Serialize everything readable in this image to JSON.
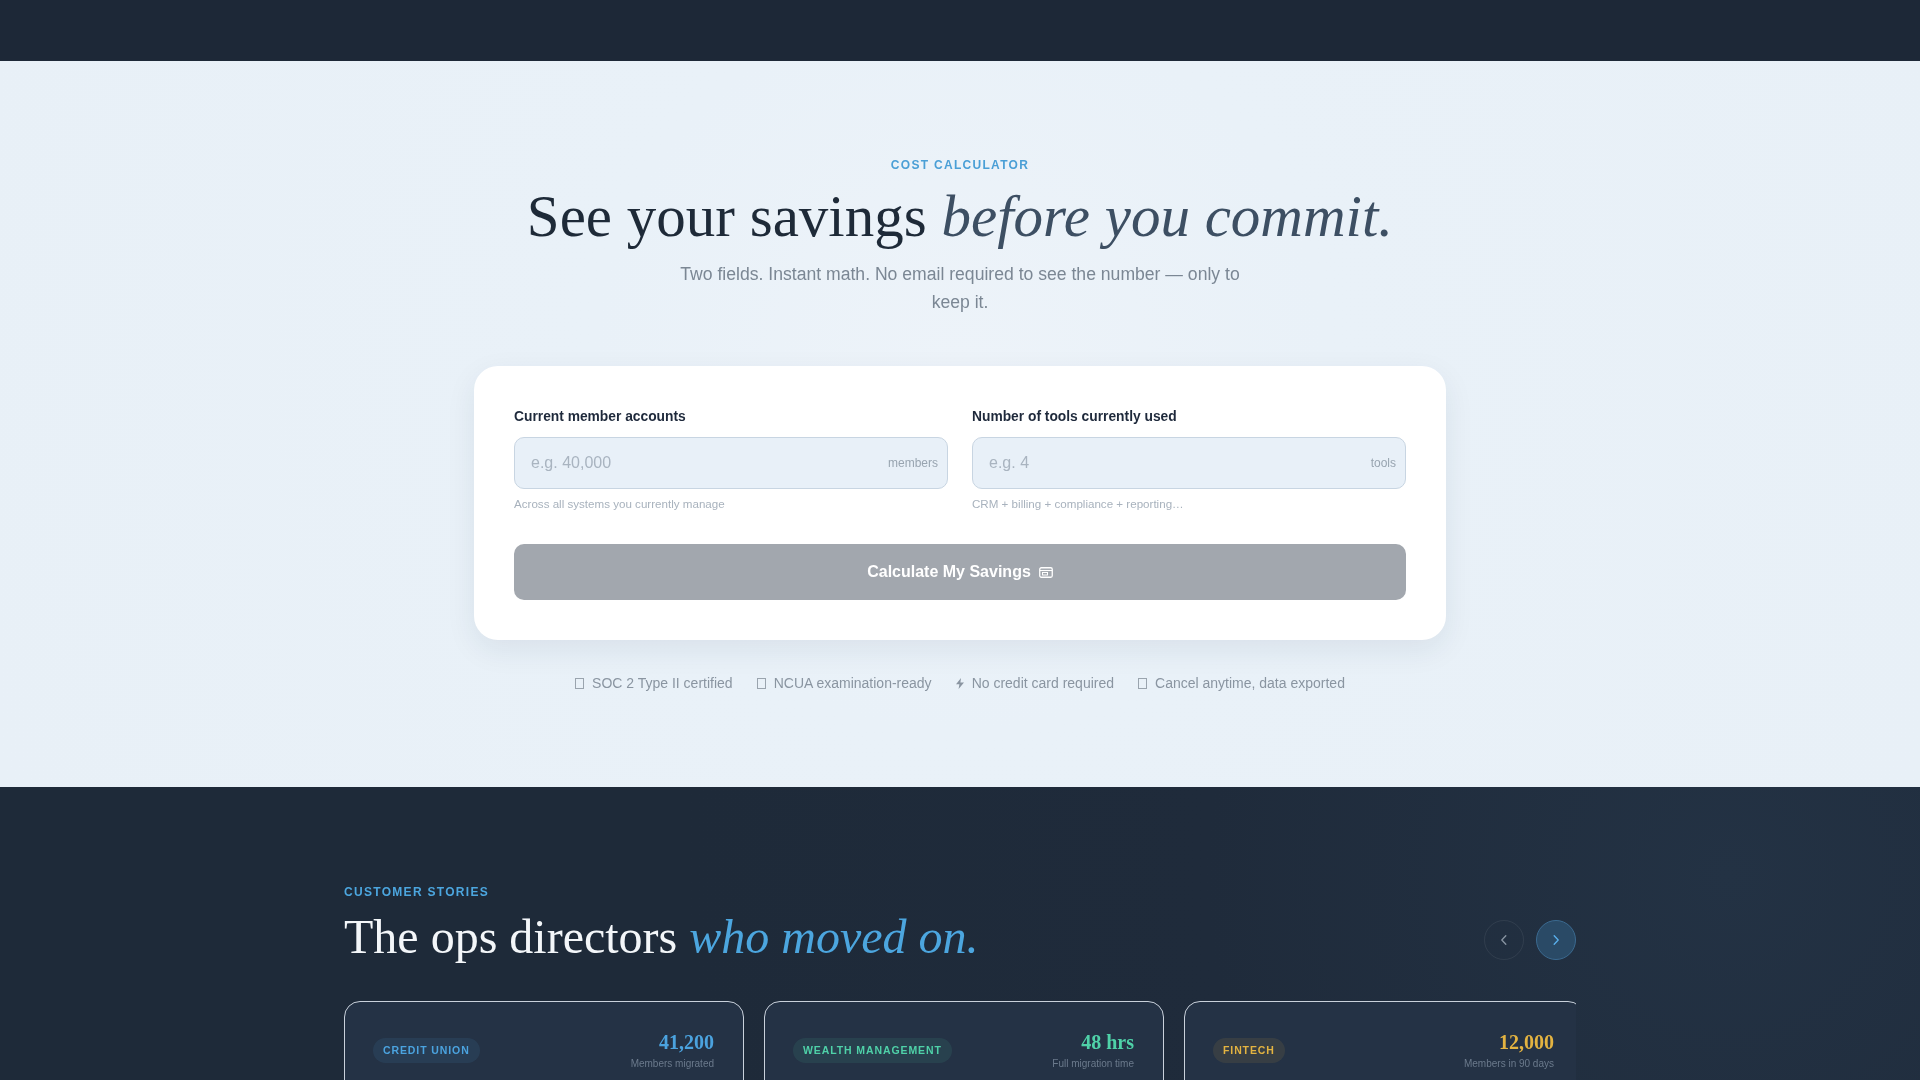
{
  "calculator": {
    "eyebrow": "COST CALCULATOR",
    "title": "See your savings *before you commit.*",
    "subtitle": "Two fields. Instant math. No email required to see the number — only to keep it.",
    "fields": [
      {
        "label": "Current member accounts",
        "placeholder": "e.g. 40,000",
        "unit": "members",
        "hint": "Across all systems you currently manage"
      },
      {
        "label": "Number of tools currently used",
        "placeholder": "e.g. 4",
        "unit": "tools",
        "hint": "CRM + billing + compliance + reporting…"
      }
    ],
    "button": {
      "label": "Calculate My Savings",
      "disabled": true
    },
    "badges": [
      {
        "kind": "box",
        "text": "SOC 2 Type II certified"
      },
      {
        "kind": "box",
        "text": "NCUA examination-ready"
      },
      {
        "kind": "bolt",
        "text": "No credit card required"
      },
      {
        "kind": "box",
        "text": "Cancel anytime, data exported"
      }
    ]
  },
  "stories": {
    "eyebrow": "CUSTOMER STORIES",
    "title": "The ops directors *who moved on.*",
    "nav": [
      {
        "kind": "prev",
        "disabled": true
      },
      {
        "kind": "next",
        "disabled": false
      }
    ],
    "cards": [
      {
        "tag": "CREDIT UNION",
        "value": "41,200",
        "caption": "Members migrated",
        "color": "#4ba3df"
      },
      {
        "tag": "WEALTH MANAGEMENT",
        "value": "48 hrs",
        "caption": "Full migration time",
        "color": "#4fd1a8"
      },
      {
        "tag": "FINTECH",
        "value": "12,000",
        "caption": "Members in 90 days",
        "color": "#e3b341"
      }
    ]
  }
}
